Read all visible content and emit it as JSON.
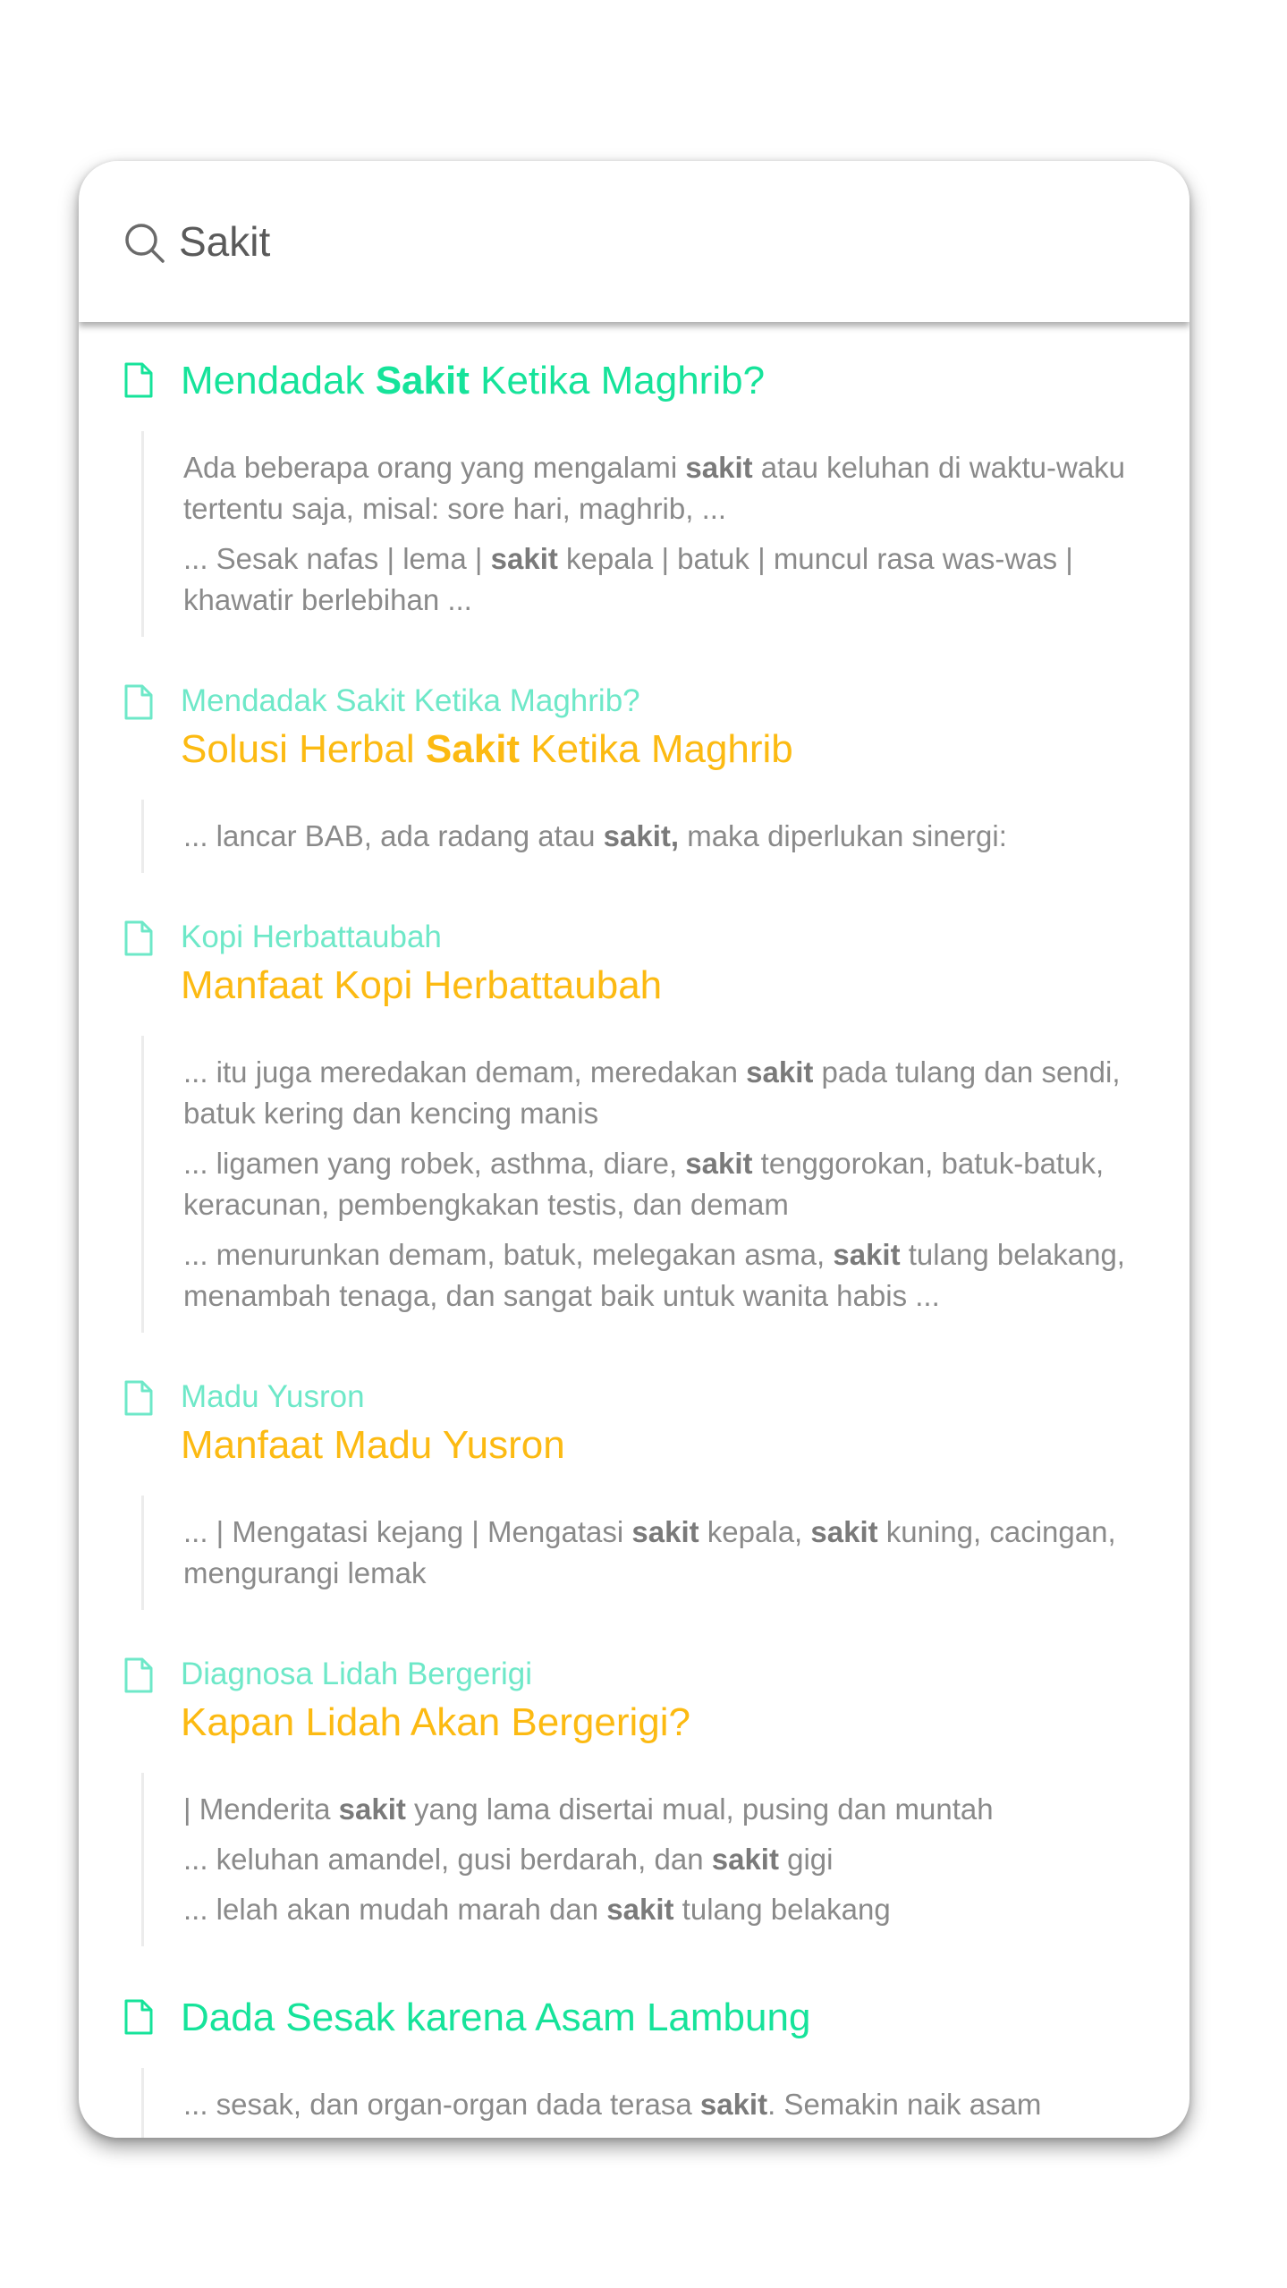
{
  "search": {
    "value": "Sakit",
    "query": "sakit"
  },
  "colors": {
    "title_green": "#16e39a",
    "title_yellow": "#fcba12",
    "parent_green": "#6ee8c8",
    "snippet_text": "#8a8a8a"
  },
  "results": [
    {
      "parent": "",
      "title": "Mendadak Sakit Ketika Maghrib?",
      "title_color": "green",
      "icon": "document-icon",
      "snippets": [
        "Ada beberapa orang yang mengalami sakit atau keluhan di waktu-waku tertentu saja, misal: sore hari, maghrib, ...",
        "... Sesak nafas | lema | sakit kepala | batuk | muncul rasa was-was | khawatir berlebihan ..."
      ]
    },
    {
      "parent": "Mendadak Sakit Ketika Maghrib?",
      "title": "Solusi Herbal Sakit Ketika Maghrib",
      "title_color": "yellow",
      "icon": "document-icon",
      "snippets": [
        "... lancar BAB, ada radang atau sakit, maka diperlukan sinergi:"
      ]
    },
    {
      "parent": "Kopi Herbattaubah",
      "title": "Manfaat Kopi Herbattaubah",
      "title_color": "yellow",
      "icon": "document-icon",
      "snippets": [
        "... itu juga meredakan demam, meredakan sakit pada tulang dan sendi, batuk kering dan kencing manis",
        "... ligamen yang robek, asthma, diare, sakit tenggorokan, batuk-batuk, keracunan, pembengkakan testis, dan demam",
        "... menurunkan demam, batuk, melegakan asma, sakit tulang belakang, menambah tenaga, dan sangat baik untuk wanita habis ..."
      ]
    },
    {
      "parent": "Madu Yusron",
      "title": "Manfaat Madu Yusron",
      "title_color": "yellow",
      "icon": "document-icon",
      "snippets": [
        "... | Mengatasi kejang | Mengatasi sakit kepala, sakit kuning, cacingan, mengurangi lemak"
      ]
    },
    {
      "parent": "Diagnosa Lidah Bergerigi",
      "title": "Kapan Lidah Akan Bergerigi?",
      "title_color": "yellow",
      "icon": "document-icon",
      "snippets": [
        "| Menderita sakit yang lama disertai mual, pusing dan muntah",
        "... keluhan amandel, gusi berdarah, dan sakit gigi",
        "... lelah akan mudah marah dan sakit tulang belakang"
      ]
    },
    {
      "parent": "",
      "title": "Dada Sesak karena Asam Lambung",
      "title_color": "green",
      "icon": "document-icon",
      "snippets": [
        "... sesak, dan organ-organ dada terasa sakit. Semakin naik asam"
      ]
    }
  ]
}
